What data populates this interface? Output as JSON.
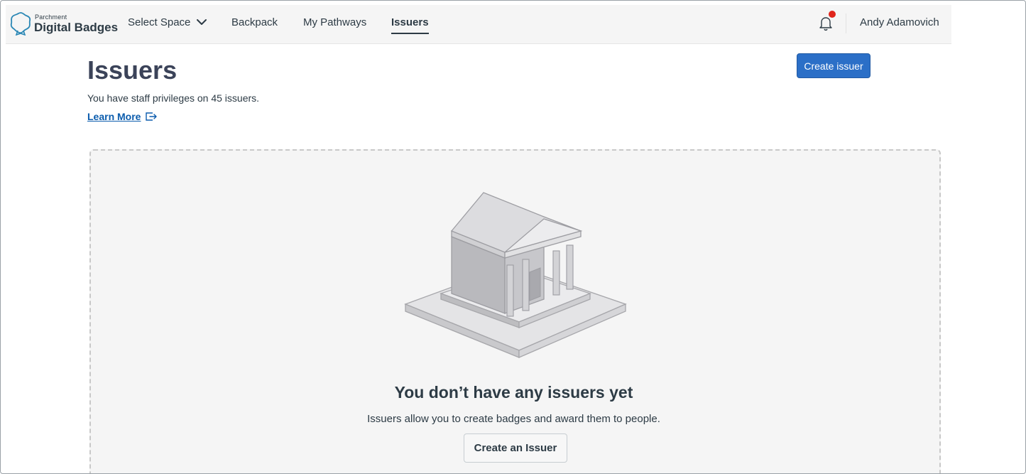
{
  "nav": {
    "logo_small": "Parchment",
    "logo_big": "Digital Badges",
    "items": [
      {
        "label": "Select Space"
      },
      {
        "label": "Backpack"
      },
      {
        "label": "My Pathways"
      },
      {
        "label": "Issuers"
      }
    ],
    "active_item": "Issuers",
    "user_name": "Andy Adamovich",
    "notification_dot_color": "#e0251b",
    "icons": [
      "parchment-logo-icon",
      "chevron-down-icon",
      "bell-icon"
    ]
  },
  "header": {
    "title": "Issuers",
    "subtext": "You have staff privileges on 45 issuers.",
    "learn_more": "Learn More",
    "create_button": "Create issuer",
    "accent_color": "#2b6fc7",
    "icons": [
      "external-link-icon"
    ]
  },
  "empty_state": {
    "title": "You don’t have any issuers yet",
    "description": "Issuers allow you to create badges and award them to people.",
    "button": "Create an Issuer",
    "icons": [
      "institution-building-illustration"
    ]
  }
}
